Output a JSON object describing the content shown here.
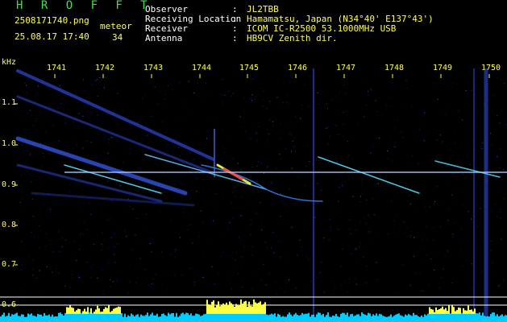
{
  "header": {
    "brand": "H R O F F T",
    "filename": "2508171740.png",
    "datetime": "25.08.17 17:40",
    "meteor_label": "meteor",
    "meteor_count": "34"
  },
  "station": [
    {
      "label": "Observer",
      "value": "JL2TBB"
    },
    {
      "label": "Receiving Location",
      "value": "Hamamatsu, Japan (N34°40' E137°43')"
    },
    {
      "label": "Receiver",
      "value": "ICOM IC-R2500 53.1000MHz USB"
    },
    {
      "label": "Antenna",
      "value": "HB9CV Zenith dir."
    }
  ],
  "separator": ":",
  "axis": {
    "y_unit": "kHz",
    "y_ticks": [
      "1.1",
      "1.0",
      "0.9",
      "0.8",
      "0.7",
      "0.6"
    ],
    "x_ticks": [
      "1741",
      "1742",
      "1743",
      "1744",
      "1745",
      "1746",
      "1747",
      "1748",
      "1749",
      "1750"
    ]
  },
  "colors": {
    "background": "#000000",
    "tick_label": "#ffff55",
    "brand": "#3fe04a",
    "reference_line": "#ffffff",
    "signal_hot": "#ff4040",
    "signal_mid": "#ffff44",
    "signal_low": "#3366ff",
    "noise_floor": "#00ccff"
  }
}
